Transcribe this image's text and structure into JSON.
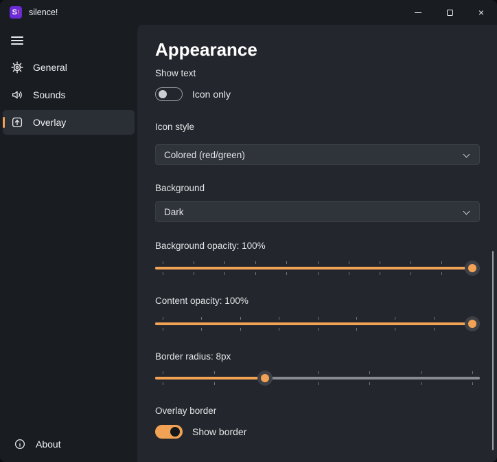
{
  "titlebar": {
    "title": "silence!",
    "logo_text": "S",
    "logo_accent": "!"
  },
  "sidebar": {
    "items": [
      {
        "label": "General",
        "icon": "gear-icon",
        "selected": false
      },
      {
        "label": "Sounds",
        "icon": "speaker-icon",
        "selected": false
      },
      {
        "label": "Overlay",
        "icon": "overlay-arrow-icon",
        "selected": true
      }
    ],
    "footer": {
      "label": "About",
      "icon": "info-icon"
    }
  },
  "content": {
    "heading": "Appearance",
    "show_text": {
      "label": "Show text",
      "toggle_label": "Icon only",
      "state": "off"
    },
    "icon_style": {
      "label": "Icon style",
      "value": "Colored (red/green)"
    },
    "background": {
      "label": "Background",
      "value": "Dark"
    },
    "sliders": [
      {
        "label": "Background opacity: 100%",
        "percent": 100,
        "tick_intervals": 10
      },
      {
        "label": "Content opacity: 100%",
        "percent": 100,
        "tick_intervals": 8
      },
      {
        "label": "Border radius: 8px",
        "percent": 33,
        "tick_intervals": 6
      }
    ],
    "overlay_border": {
      "label": "Overlay border",
      "toggle_label": "Show border",
      "state": "on"
    }
  },
  "colors": {
    "accent": "#F2A254",
    "titlebar_bg": "#191C21",
    "sidebar_bg": "#191C21",
    "content_bg": "#23262C",
    "control_bg": "#2F333A",
    "selected_item_bg": "#2A2E35",
    "logo_purple": "#6C2BD9"
  }
}
